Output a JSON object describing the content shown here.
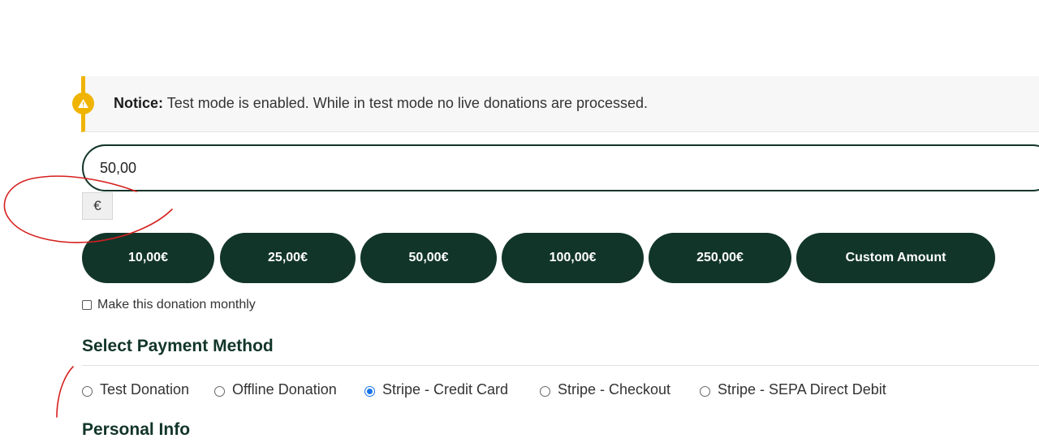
{
  "notice": {
    "label": "Notice:",
    "message": " Test mode is enabled. While in test mode no live donations are processed."
  },
  "amount": {
    "value": "50,00",
    "currency_symbol": "€"
  },
  "levels": [
    "10,00€",
    "25,00€",
    "50,00€",
    "100,00€",
    "250,00€",
    "Custom Amount"
  ],
  "monthly_label": "Make this donation monthly",
  "payment": {
    "title": "Select Payment Method",
    "gateways": [
      {
        "label": "Test Donation",
        "selected": false
      },
      {
        "label": "Offline Donation",
        "selected": false
      },
      {
        "label": "Stripe - Credit Card",
        "selected": true
      },
      {
        "label": "Stripe - Checkout",
        "selected": false
      },
      {
        "label": "Stripe - SEPA Direct Debit",
        "selected": false
      }
    ]
  },
  "personal_info_title": "Personal Info",
  "colors": {
    "accent": "#12352a",
    "notice": "#f0b400",
    "annotation": "#d6201e",
    "radio_selected": "#1a73e8"
  }
}
